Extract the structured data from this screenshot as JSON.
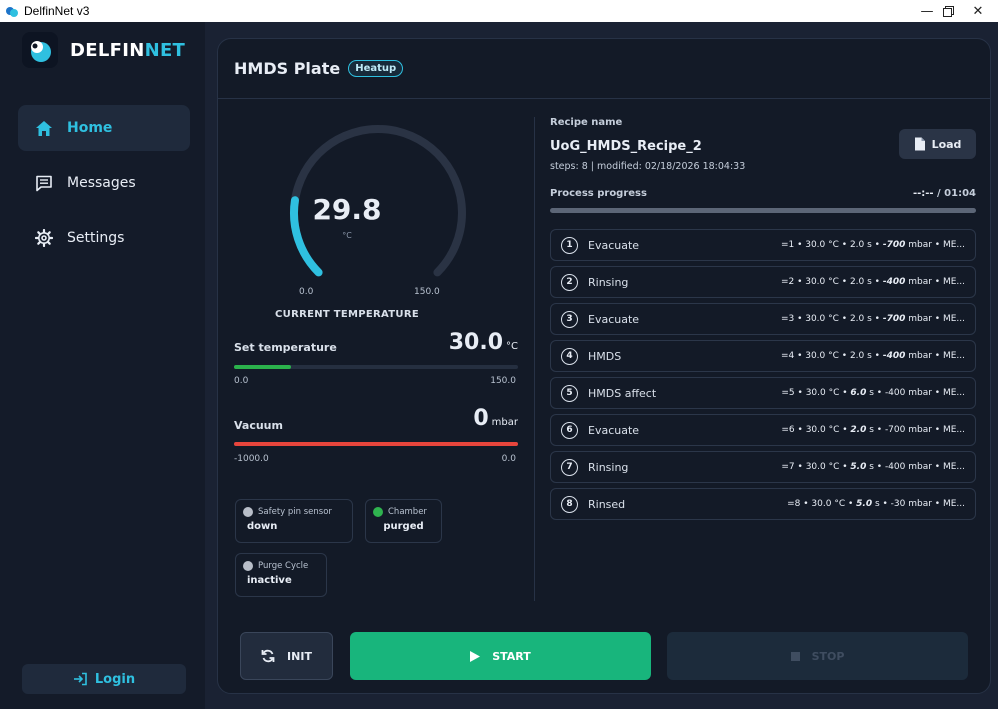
{
  "window": {
    "title": "DelfinNet v3",
    "controls": [
      "minimize",
      "maximize",
      "close"
    ]
  },
  "brand": {
    "part1": "DELFIN",
    "part2": "NET",
    "accent": "#2fc0e0"
  },
  "sidebar": {
    "items": [
      {
        "label": "Home",
        "icon": "home-icon",
        "active": true
      },
      {
        "label": "Messages",
        "icon": "message-icon",
        "active": false
      },
      {
        "label": "Settings",
        "icon": "gear-icon",
        "active": false
      }
    ],
    "login_label": "Login"
  },
  "header": {
    "title": "HMDS Plate",
    "badge": "Heatup"
  },
  "temperature": {
    "current": "29.8",
    "unit": "°C",
    "min": "0.0",
    "max": "150.0",
    "caption": "CURRENT TEMPERATURE",
    "gauge_fraction": 0.199
  },
  "set_temperature": {
    "label": "Set temperature",
    "value": "30.0",
    "unit": "°C",
    "min": "0.0",
    "max": "150.0",
    "fill_fraction": 0.2,
    "bar_color": "#2bb24c"
  },
  "vacuum": {
    "label": "Vacuum",
    "value": "0",
    "unit": "mbar",
    "min": "-1000.0",
    "max": "0.0",
    "fill_fraction": 1.0,
    "bar_color": "#e8453c"
  },
  "status": [
    {
      "label": "Safety pin sensor",
      "value": "down",
      "color": "#b8bec8"
    },
    {
      "label": "Chamber",
      "value": "purged",
      "color": "#2fb34f"
    },
    {
      "label": "Purge Cycle",
      "value": "inactive",
      "color": "#b8bec8"
    }
  ],
  "recipe": {
    "name_label": "Recipe name",
    "name": "UoG_HMDS_Recipe_2",
    "meta": "steps: 8 | modified: 02/18/2026 18:04:33",
    "load_label": "Load",
    "progress_label": "Process progress",
    "progress_current": "--:--",
    "progress_total": " / 01:04",
    "progress_fraction": 0
  },
  "steps": [
    {
      "num": "1",
      "name": "Evacuate",
      "pre": "=1 • 30.0 °C • 2.0 s • ",
      "bold": "-700",
      "post": " mbar • ME..."
    },
    {
      "num": "2",
      "name": "Rinsing",
      "pre": "=2 • 30.0 °C • 2.0 s • ",
      "bold": "-400",
      "post": " mbar • ME..."
    },
    {
      "num": "3",
      "name": "Evacuate",
      "pre": "=3 • 30.0 °C • 2.0 s • ",
      "bold": "-700",
      "post": " mbar • ME..."
    },
    {
      "num": "4",
      "name": "HMDS",
      "pre": "=4 • 30.0 °C • 2.0 s • ",
      "bold": "-400",
      "post": " mbar • ME..."
    },
    {
      "num": "5",
      "name": "HMDS affect",
      "pre": "=5 • 30.0 °C • ",
      "bold": "6.0",
      "post": " s • -400 mbar • ME..."
    },
    {
      "num": "6",
      "name": "Evacuate",
      "pre": "=6 • 30.0 °C • ",
      "bold": "2.0",
      "post": " s • -700 mbar • ME..."
    },
    {
      "num": "7",
      "name": "Rinsing",
      "pre": "=7 • 30.0 °C • ",
      "bold": "5.0",
      "post": " s • -400 mbar • ME..."
    },
    {
      "num": "8",
      "name": "Rinsed",
      "pre": "=8 • 30.0 °C • ",
      "bold": "5.0",
      "post": " s • -30 mbar • ME..."
    }
  ],
  "actions": {
    "init": "INIT",
    "start": "START",
    "stop": "STOP"
  }
}
